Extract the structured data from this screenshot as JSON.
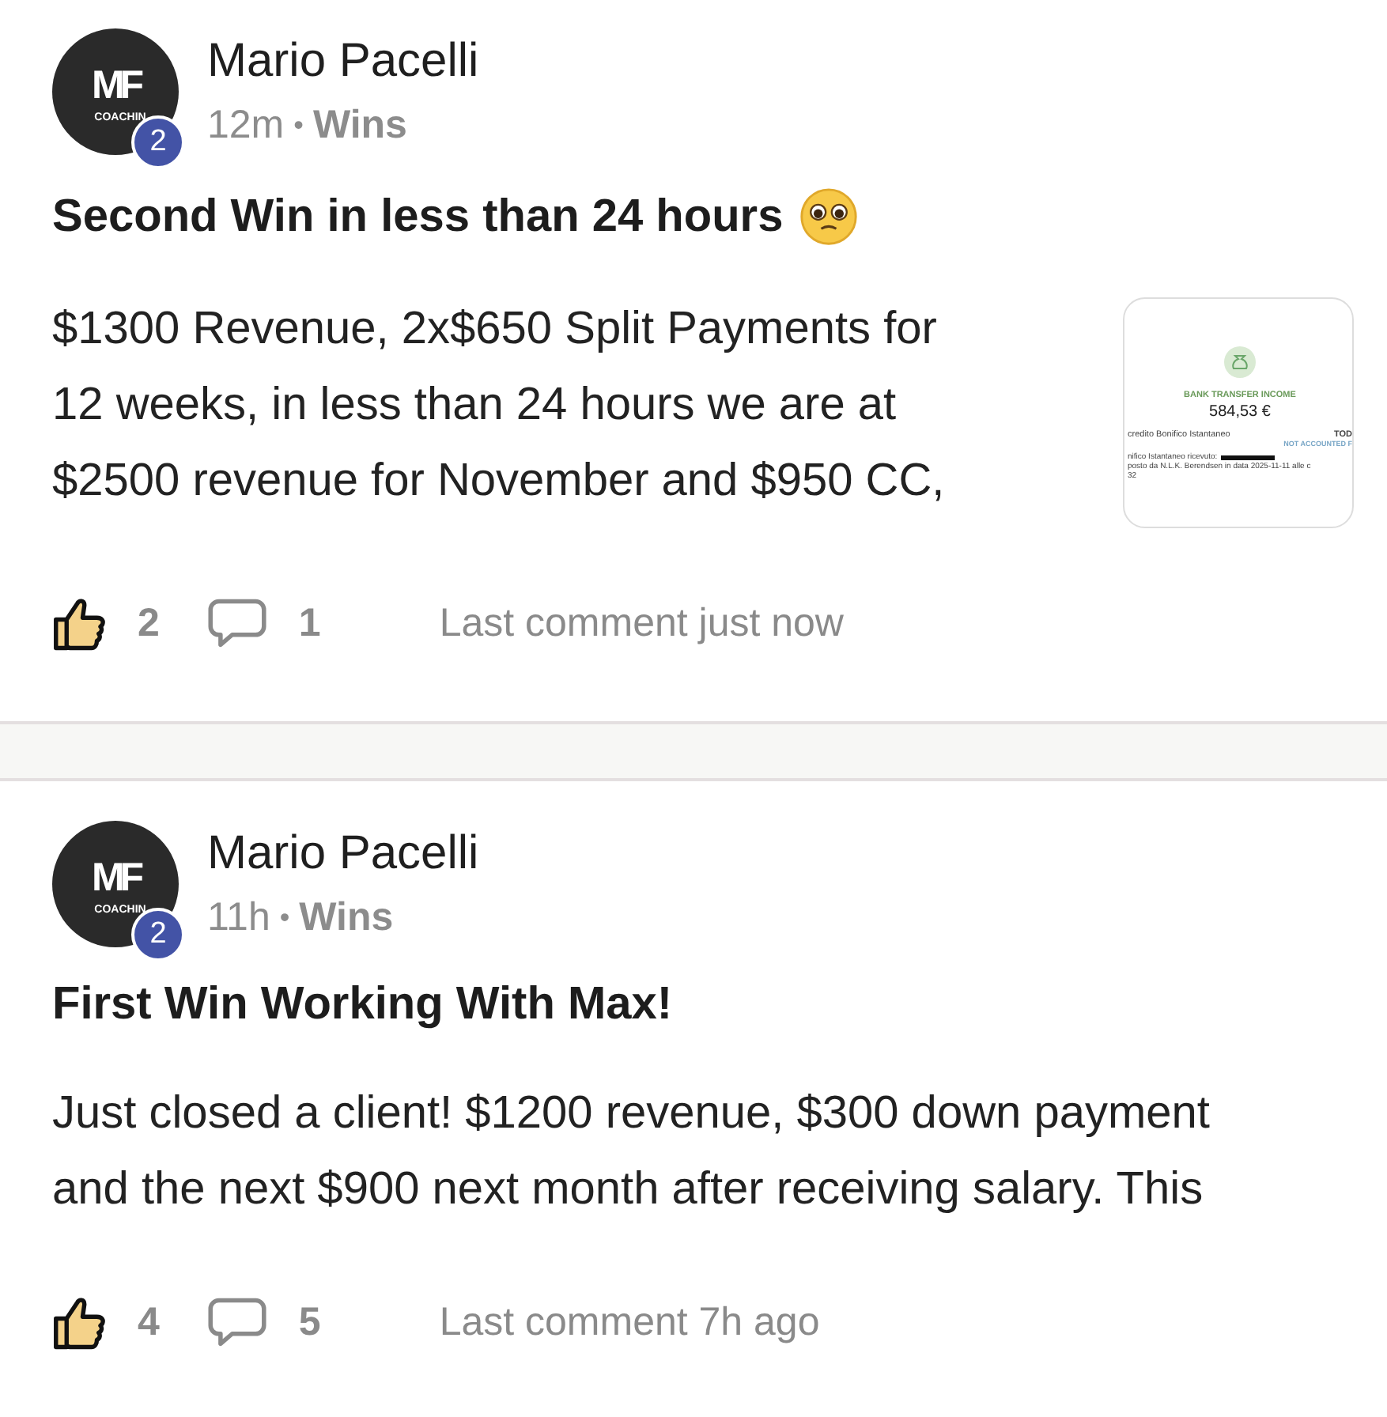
{
  "posts": [
    {
      "author": "Mario Pacelli",
      "avatar": {
        "logo": "MF",
        "tagline": "COACHIN",
        "badge": "2"
      },
      "time": "12m",
      "separator": "•",
      "category": "Wins",
      "title": "Second Win in less than 24 hours",
      "emoji": true,
      "body": "$1300 Revenue, 2x$650 Split Payments for 12 weeks, in less than 24 hours we are at $2500 revenue for November and $950 CC,",
      "attachment": {
        "kind": "screenshot",
        "label": "BANK TRANSFER INCOME",
        "amount": "584,53 €",
        "row_left": "credito Bonifico Istantaneo",
        "row_right": "TOD",
        "status": "NOT ACCOUNTED F",
        "detail_1": "nifico Istantaneo ricevuto:",
        "detail_2": "posto da N.L.K. Berendsen in data 2025-11-11 alle c",
        "detail_3": "32"
      },
      "likes": "2",
      "comments": "1",
      "last_comment": "Last comment just now"
    },
    {
      "author": "Mario Pacelli",
      "avatar": {
        "logo": "MF",
        "tagline": "COACHIN",
        "badge": "2"
      },
      "time": "11h",
      "separator": "•",
      "category": "Wins",
      "title": "First Win Working With Max!",
      "emoji": false,
      "body": "Just closed a client! $1200 revenue, $300 down payment and the next $900 next month after receiving salary. This",
      "likes": "4",
      "comments": "5",
      "last_comment": "Last comment 7h ago"
    }
  ]
}
